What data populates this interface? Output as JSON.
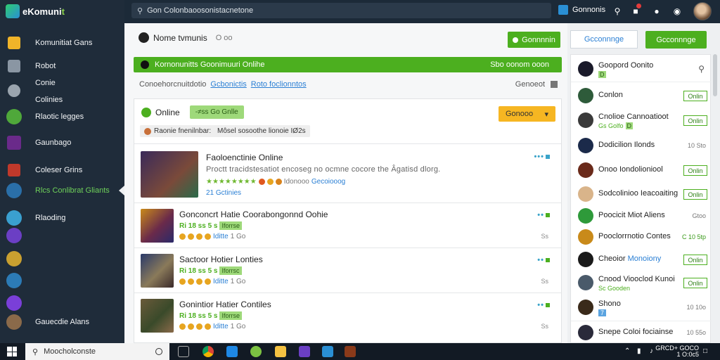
{
  "app": {
    "logo_text_a": "eKomuni",
    "logo_text_b": "t"
  },
  "sidebar": {
    "items": [
      {
        "label": "Komunitiat Gans",
        "icon": "folder-icon",
        "color": "#f0b429"
      },
      {
        "label": "Robot",
        "icon": "robot-icon",
        "color": "#8a96a3"
      },
      {
        "label": "Conie",
        "icon": "",
        "color": ""
      },
      {
        "label": "Colinies",
        "icon": "gear-icon",
        "color": "#9aa4ae"
      },
      {
        "label": "Rlaotic legges",
        "icon": "game-avatar-icon",
        "color": "#4fa83a"
      },
      {
        "label": "Gaunbago",
        "icon": "game-avatar-icon",
        "color": "#6a2a8a"
      },
      {
        "label": "Coleser Grins",
        "icon": "game-avatar-icon",
        "color": "#c0392b"
      },
      {
        "label": "Rlcs Conlibrat Gliants",
        "icon": "game-avatar-icon",
        "color": "#2a6fa8",
        "badge": "Rlcs"
      },
      {
        "label": "Rlaoding",
        "icon": "game-avatar-icon",
        "color": "#3aa0d0"
      },
      {
        "label": "Gauecdie Alans",
        "icon": "game-avatar-icon",
        "color": "#8a6a4a"
      }
    ],
    "extra_icons": [
      {
        "name": "purple-game-icon",
        "color": "#6b3fc4"
      },
      {
        "name": "gold-game-icon",
        "color": "#c9a030"
      },
      {
        "name": "blue-game-icon",
        "color": "#2c7bb6"
      },
      {
        "name": "violet-game-icon",
        "color": "#7a3fd8"
      }
    ]
  },
  "topbar": {
    "search_placeholder": "Gon Colonbaoosonistacnetone",
    "user_label": "Gonnonis"
  },
  "main": {
    "page_title": "Nome tvmunis",
    "page_hint": "O oo",
    "primary_button": "Gonnnnin",
    "banner_left": "Kornonunitts Goonimuuri Onlihe",
    "banner_right": "Sbo oonom ooon",
    "subbar_text": "Conoehorcnuitdotio",
    "subbar_link": "Gcbonictis",
    "subbar_link2": "Roto foclionntos",
    "subbar_right": "Genoeot",
    "status_label": "Online",
    "status_pill": "-≠ss Go Gnlle",
    "dropdown_label": "Gonooo",
    "filters": [
      "Raonie fnenilnbar:",
      "Môsel sosoothe lionoie IØ2s"
    ],
    "items": [
      {
        "title": "Faoloenctinie Online",
        "desc": "Proctt tracidstesatiot encoseg no ocmne cocore the Âgatisd dlorg.",
        "meta_link": "Idonooo",
        "meta_link2": "Gecoiooog",
        "sub": "21 Gctinies"
      },
      {
        "title": "Gonconcrt Hatie Coorabongonnd Oohie",
        "meta": "Ri 18 ss 5 s",
        "tag": "Iforrse",
        "link": "Iditte",
        "grey": "1 Go",
        "count": "Ss"
      },
      {
        "title": "Sactoor Hotier Lonties",
        "meta": "Ri 18 ss 5 s",
        "tag": "Iforrsc",
        "link": "Iditte",
        "grey": "1 Go",
        "count": "Ss"
      },
      {
        "title": "Gonintior Hatier Contiles",
        "meta": "Ri 18 ss 5 s",
        "tag": "Iforrse",
        "link": "Iditte",
        "grey": "1 Go",
        "count": "Ss"
      }
    ]
  },
  "right_panel": {
    "outline_button": "Gcconnnge",
    "green_button": "Gcconnnge",
    "friends": [
      {
        "name": "Goopord Oonito",
        "sub": "D",
        "sub_style": "green-badge",
        "right": "close",
        "color": "#1a1a2a"
      },
      {
        "name": "Conlon",
        "sub": "",
        "right": "button",
        "btn": "Onlin",
        "color": "#2e5b3a"
      },
      {
        "name": "Cnolioe Cannoatioot",
        "sub": "Gs Golfo",
        "sub_badge": "D",
        "right": "button",
        "btn": "Onlin",
        "color": "#3a3a3a"
      },
      {
        "name": "Dodicilion Ilonds",
        "sub": "",
        "right": "time",
        "tm": "10 Sto",
        "color": "#1b2a4a"
      },
      {
        "name": "Onoo Iondolioniool",
        "sub": "",
        "right": "button",
        "btn": "Onlin",
        "color": "#6a2a1a"
      },
      {
        "name": "Sodcolinioo Ieacoaiting",
        "sub": "",
        "right": "button",
        "btn": "Onlin",
        "color": "#d9b48a"
      },
      {
        "name": "Poocicit Miot Aliens",
        "sub": "",
        "right": "time",
        "tm": "Gtoo",
        "color": "#2e9a3a"
      },
      {
        "name": "Pooclorrnotio Contes",
        "sub": "",
        "right": "time-green",
        "tm": "C 10 5tp",
        "color": "#c98a1a"
      },
      {
        "name": "Cheoior",
        "name_link": "Monoiony",
        "sub": "",
        "right": "button",
        "btn": "Onlin",
        "color": "#1a1a1a"
      },
      {
        "name": "Cnood Viooclod Kunoi",
        "sub": "Sc Gooden",
        "right": "button",
        "btn": "Onlin",
        "color": "#4a5a6a"
      },
      {
        "name": "Shono",
        "sub": "",
        "sub_badge_blue": "7",
        "right": "time",
        "tm": "10 10o",
        "color": "#3a2a1a"
      },
      {
        "name": "Snepe Coloi fociainse",
        "sub": "",
        "right": "time",
        "tm": "10 55o",
        "color": "#2a2a3a"
      }
    ]
  },
  "taskbar": {
    "search_placeholder": "Moocholconste",
    "tray_time": "GRCD+ GOCO",
    "tray_date": "1 O:0c5"
  }
}
